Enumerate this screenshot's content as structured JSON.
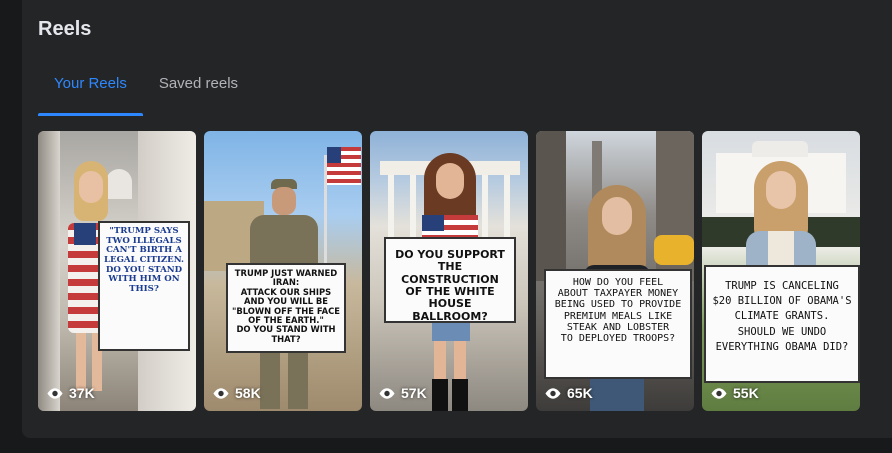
{
  "section": {
    "title": "Reels"
  },
  "tabs": [
    {
      "label": "Your Reels",
      "active": true
    },
    {
      "label": "Saved reels",
      "active": false
    }
  ],
  "reels": [
    {
      "sign_text": "\"TRUMP SAYS\nTWO ILLEGALS\nCAN'T BIRTH A\nLEGAL CITIZEN.\nDO YOU STAND\nWITH HIM ON THIS?",
      "views": "37K"
    },
    {
      "sign_text": "TRUMP JUST WARNED IRAN:\nATTACK OUR SHIPS\nAND YOU WILL BE\n\"BLOWN OFF THE FACE\nOF THE EARTH.\"\nDO YOU STAND WITH THAT?",
      "views": "58K"
    },
    {
      "sign_text": "DO YOU SUPPORT\nTHE CONSTRUCTION\nOF THE WHITE HOUSE\nBALLROOM?",
      "views": "57K"
    },
    {
      "sign_text": "HOW DO YOU FEEL\nABOUT TAXPAYER MONEY\nBEING USED TO PROVIDE\nPREMIUM MEALS LIKE\nSTEAK AND LOBSTER\nTO DEPLOYED TROOPS?",
      "views": "65K"
    },
    {
      "sign_text": "TRUMP IS CANCELING\n$20 BILLION OF OBAMA'S\nCLIMATE GRANTS.\nSHOULD WE UNDO\nEVERYTHING OBAMA DID?",
      "views": "55K"
    }
  ],
  "icons": {
    "views": "eye-icon"
  },
  "colors": {
    "accent": "#2d88ff",
    "panel": "#242526",
    "background": "#18191a"
  }
}
